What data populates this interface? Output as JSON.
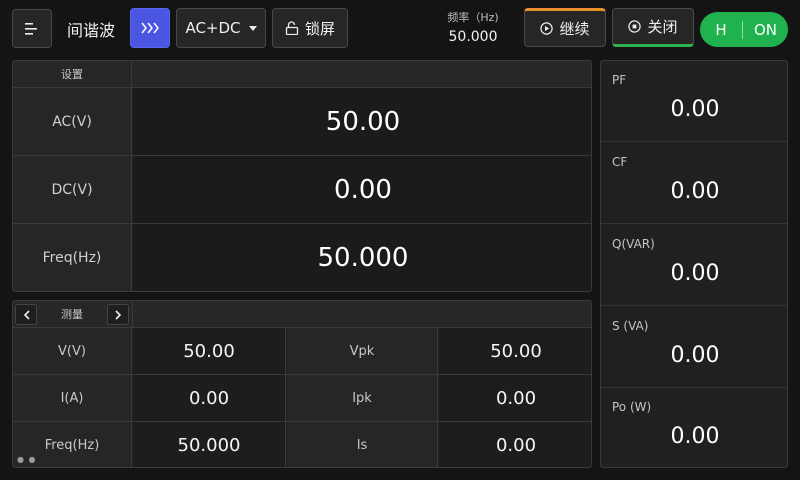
{
  "header": {
    "title": "间谐波",
    "mode_label": "AC+DC",
    "lock_label": "锁屏",
    "frequency_label": "频率（Hz)",
    "frequency_value": "50.000",
    "continue_label": "继续",
    "close_label": "关闭",
    "power_toggle": {
      "left_label": "H",
      "right_label": "ON",
      "color": "#1fb24f"
    }
  },
  "settings": {
    "header": "设置",
    "rows": [
      {
        "label": "AC(V)",
        "value": "50.00"
      },
      {
        "label": "DC(V)",
        "value": "0.00"
      },
      {
        "label": "Freq(Hz)",
        "value": "50.000"
      }
    ]
  },
  "measure": {
    "header": "测量",
    "rows": [
      {
        "label1": "V(V)",
        "value1": "50.00",
        "label2": "Vpk",
        "value2": "50.00"
      },
      {
        "label1": "I(A)",
        "value1": "0.00",
        "label2": "Ipk",
        "value2": "0.00"
      },
      {
        "label1": "Freq(Hz)",
        "value1": "50.000",
        "label2": "Is",
        "value2": "0.00"
      }
    ]
  },
  "power_panel": {
    "items": [
      {
        "label": "PF",
        "value": "0.00"
      },
      {
        "label": "CF",
        "value": "0.00"
      },
      {
        "label": "Q(VAR)",
        "value": "0.00"
      },
      {
        "label": "S (VA)",
        "value": "0.00"
      },
      {
        "label": "Po (W)",
        "value": "0.00"
      }
    ]
  },
  "icons": {
    "menu": "menu-icon",
    "forward": "double-chevron-right-icon",
    "dropdown": "caret-down-icon",
    "lock": "unlock-icon",
    "play": "play-circle-icon",
    "stop": "stop-circle-icon",
    "prev": "chevron-left-icon",
    "next": "chevron-right-icon"
  },
  "colors": {
    "accent_blue": "#4a55e0",
    "continue_orange": "#e8902c",
    "close_green": "#2fb24f",
    "background": "#141414"
  }
}
